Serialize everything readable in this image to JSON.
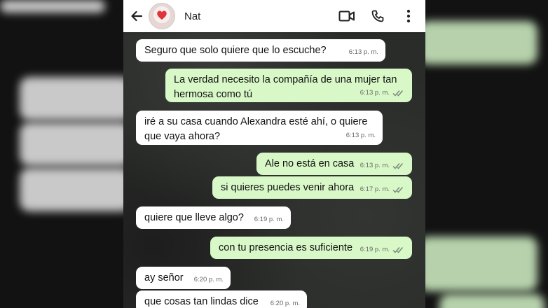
{
  "header": {
    "contact_name": "Nat",
    "icons": {
      "back": "back-arrow-icon",
      "avatar": "heart-avatar-icon",
      "video": "video-call-icon",
      "call": "phone-call-icon",
      "menu": "more-vert-icon"
    }
  },
  "messages": [
    {
      "direction": "in",
      "text": "Seguro que solo quiere que lo escuche?",
      "time": "6:13 p. m.",
      "read": false
    },
    {
      "direction": "out",
      "text": "La verdad necesito la compañía de una mujer tan hermosa como tú",
      "time": "6:13 p. m.",
      "read": true
    },
    {
      "direction": "in",
      "text": "iré a su casa cuando Alexandra esté ahí, o quiere que vaya ahora?",
      "time": "6:13 p. m.",
      "read": false
    },
    {
      "direction": "out",
      "text": "Ale no está en casa",
      "time": "6:13 p. m.",
      "read": true
    },
    {
      "direction": "out",
      "text": "si quieres puedes venir ahora",
      "time": "6:17 p. m.",
      "read": true
    },
    {
      "direction": "in",
      "text": "quiere que lleve algo?",
      "time": "6:19 p. m.",
      "read": false
    },
    {
      "direction": "out",
      "text": "con tu presencia es suficiente",
      "time": "6:19 p. m.",
      "read": true
    },
    {
      "direction": "in",
      "text": "ay señor",
      "time": "6:20 p. m.",
      "read": false
    },
    {
      "direction": "in",
      "text": "que cosas tan lindas dice",
      "time": "6:20 p. m.",
      "read": false
    }
  ],
  "colors": {
    "incoming": "#ffffff",
    "outgoing": "#d8f8c8",
    "read_ticks": "#53bdeb",
    "tick_gray": "#7a8a7a"
  }
}
